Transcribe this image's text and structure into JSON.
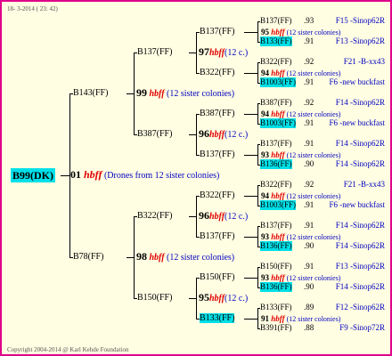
{
  "header": "18- 3-2014 ( 23: 42)",
  "footer": "Copyright 2004-2014 @ Karl Kehde Foundation",
  "root": "B99(DK)",
  "gen1": {
    "num": "01",
    "hbff": "hbff",
    "note": "(Drones from 12 sister colonies)"
  },
  "gen2": [
    {
      "name": "B143(FF)",
      "num": "99",
      "hbff": "hbff",
      "note": "(12 sister colonies)"
    },
    {
      "name": "B78(FF)",
      "num": "98",
      "hbff": "hbff",
      "note": "(12 sister colonies)"
    }
  ],
  "gen3": [
    {
      "name": "B137(FF)",
      "num": "97",
      "hbff": "hbff",
      "note": "(12 c.)"
    },
    {
      "name": "B387(FF)",
      "num": "96",
      "hbff": "hbff",
      "note": "(12 c.)"
    },
    {
      "name": "B322(FF)",
      "num": "96",
      "hbff": "hbff",
      "note": "(12 c.)"
    },
    {
      "name": "B150(FF)",
      "num": "95",
      "hbff": "hbff",
      "note": "(12 c.)"
    }
  ],
  "gen4": [
    {
      "name": "B137(FF)",
      "hl": false,
      "num": "95",
      "hbff": "hbff",
      "note": "(12 sister colonies)"
    },
    {
      "name": "B322(FF)",
      "hl": false,
      "num": "94",
      "hbff": "hbff",
      "note": "(12 sister colonies)"
    },
    {
      "name": "B387(FF)",
      "hl": false,
      "num": "94",
      "hbff": "hbff",
      "note": "(12 sister colonies)"
    },
    {
      "name": "B137(FF)",
      "hl": false,
      "num": "93",
      "hbff": "hbff",
      "note": "(12 sister colonies)"
    },
    {
      "name": "B322(FF)",
      "hl": false,
      "num": "94",
      "hbff": "hbff",
      "note": "(12 sister colonies)"
    },
    {
      "name": "B137(FF)",
      "hl": false,
      "num": "93",
      "hbff": "hbff",
      "note": "(12 sister colonies)"
    },
    {
      "name": "B150(FF)",
      "hl": false,
      "num": "93",
      "hbff": "hbff",
      "note": "(12 sister colonies)"
    },
    {
      "name": "B133(FF)",
      "hl": true,
      "num": "91",
      "hbff": "hbff",
      "note": "(12 sister colonies)"
    }
  ],
  "gen5": [
    {
      "name": "B137(FF)",
      "year": ".93",
      "loc": "F15 -Sinop62R",
      "hl": false
    },
    {
      "name": "B133(FF)",
      "year": ".91",
      "loc": "F13 -Sinop62R",
      "hl": true
    },
    {
      "name": "B322(FF)",
      "year": ".92",
      "loc": "F21 -B-xx43",
      "hl": false
    },
    {
      "name": "B1003(FF)",
      "year": ".91",
      "loc": "F6 -new buckfast",
      "hl": true
    },
    {
      "name": "B387(FF)",
      "year": ".92",
      "loc": "F14 -Sinop62R",
      "hl": false
    },
    {
      "name": "B1003(FF)",
      "year": ".91",
      "loc": "F6 -new buckfast",
      "hl": true
    },
    {
      "name": "B137(FF)",
      "year": ".91",
      "loc": "F14 -Sinop62R",
      "hl": false
    },
    {
      "name": "B136(FF)",
      "year": ".90",
      "loc": "F14 -Sinop62R",
      "hl": true
    },
    {
      "name": "B322(FF)",
      "year": ".92",
      "loc": "F21 -B-xx43",
      "hl": false
    },
    {
      "name": "B1003(FF)",
      "year": ".91",
      "loc": "F6 -new buckfast",
      "hl": true
    },
    {
      "name": "B137(FF)",
      "year": ".91",
      "loc": "F14 -Sinop62R",
      "hl": false
    },
    {
      "name": "B136(FF)",
      "year": ".90",
      "loc": "F14 -Sinop62R",
      "hl": true
    },
    {
      "name": "B150(FF)",
      "year": ".91",
      "loc": "F13 -Sinop62R",
      "hl": false
    },
    {
      "name": "B136(FF)",
      "year": ".90",
      "loc": "F14 -Sinop62R",
      "hl": true
    },
    {
      "name": "B133(FF)",
      "year": ".89",
      "loc": "F12 -Sinop62R",
      "hl": false
    },
    {
      "name": "B391(FF)",
      "year": ".88",
      "loc": "F9 -Sinop72R",
      "hl": false
    }
  ]
}
